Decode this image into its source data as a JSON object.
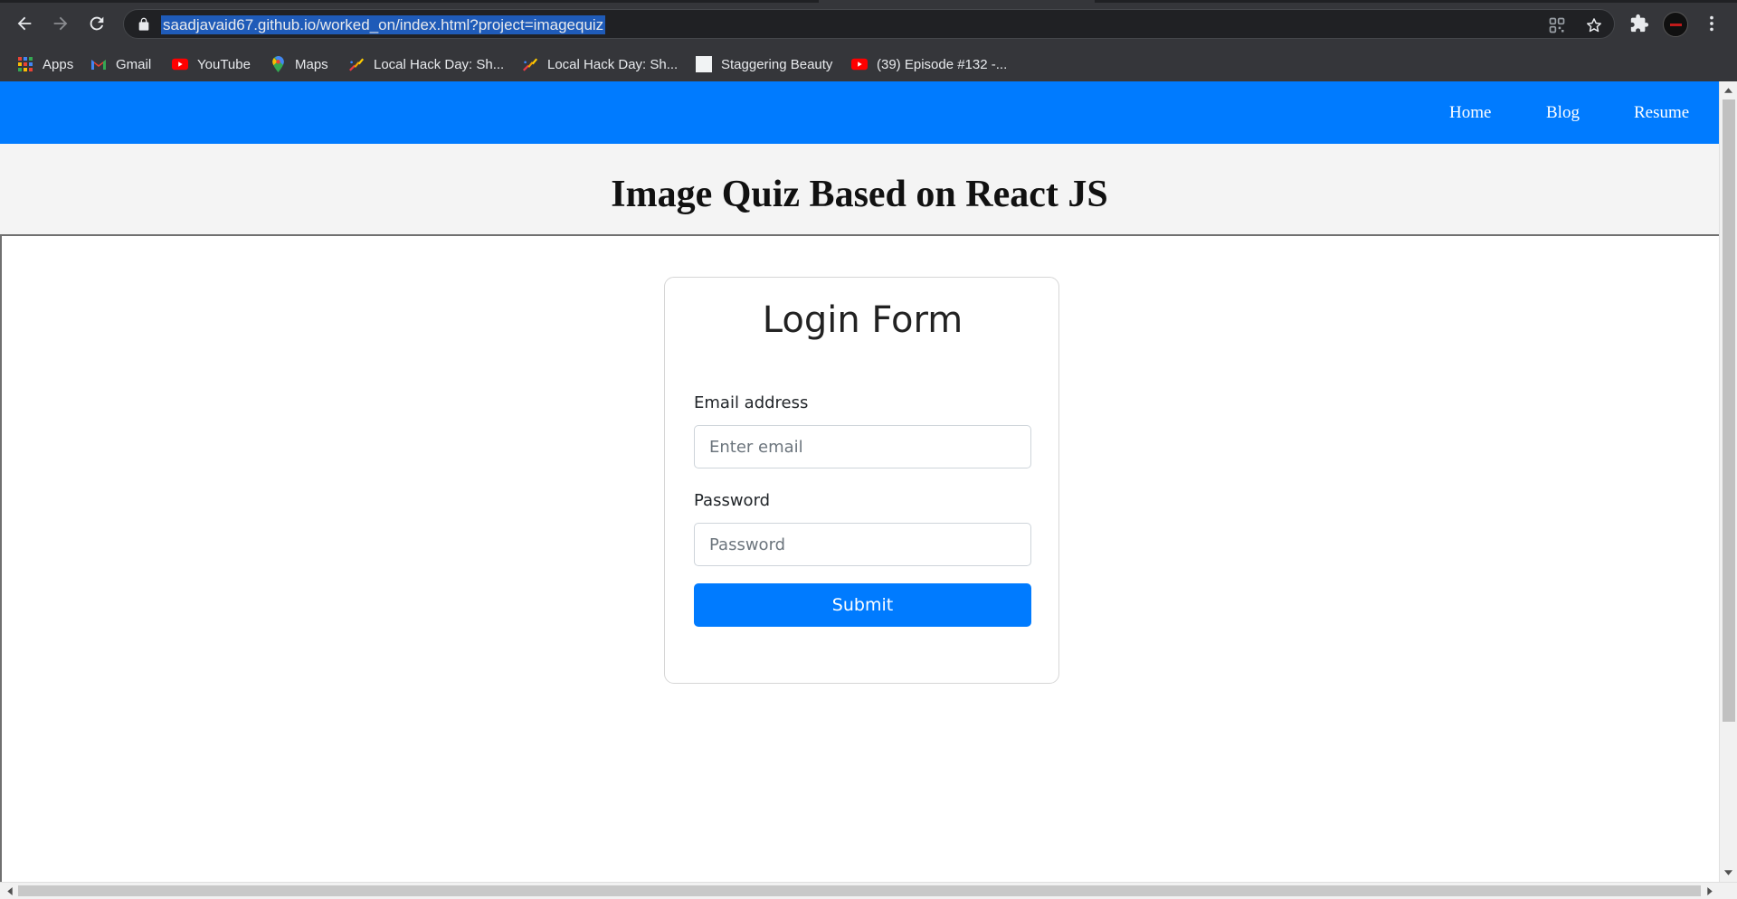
{
  "browser": {
    "url": "saadjavaid67.github.io/worked_on/index.html?project=imagequiz",
    "toolbar_icons": [
      "back-arrow-icon",
      "forward-arrow-icon",
      "reload-icon",
      "lock-icon",
      "qr-code-icon",
      "star-icon",
      "extensions-puzzle-icon",
      "profile-avatar",
      "kebab-menu-icon"
    ],
    "bookmarks": [
      {
        "label": "Apps",
        "icon": "apps-grid-icon"
      },
      {
        "label": "Gmail",
        "icon": "gmail-icon"
      },
      {
        "label": "YouTube",
        "icon": "youtube-icon"
      },
      {
        "label": "Maps",
        "icon": "maps-pin-icon"
      },
      {
        "label": "Local Hack Day: Sh...",
        "icon": "mlh-icon"
      },
      {
        "label": "Local Hack Day: Sh...",
        "icon": "mlh-icon"
      },
      {
        "label": "Staggering Beauty",
        "icon": "blank-page-icon"
      },
      {
        "label": "(39) Episode #132 -...",
        "icon": "youtube-icon"
      }
    ]
  },
  "navbar": {
    "color": "#007bff",
    "links": [
      "Home",
      "Blog",
      "Resume"
    ]
  },
  "header": {
    "title": "Image Quiz Based on React JS"
  },
  "login_form": {
    "title": "Login Form",
    "email_label": "Email address",
    "email_placeholder": "Enter email",
    "password_label": "Password",
    "password_placeholder": "Password",
    "submit_label": "Submit"
  }
}
